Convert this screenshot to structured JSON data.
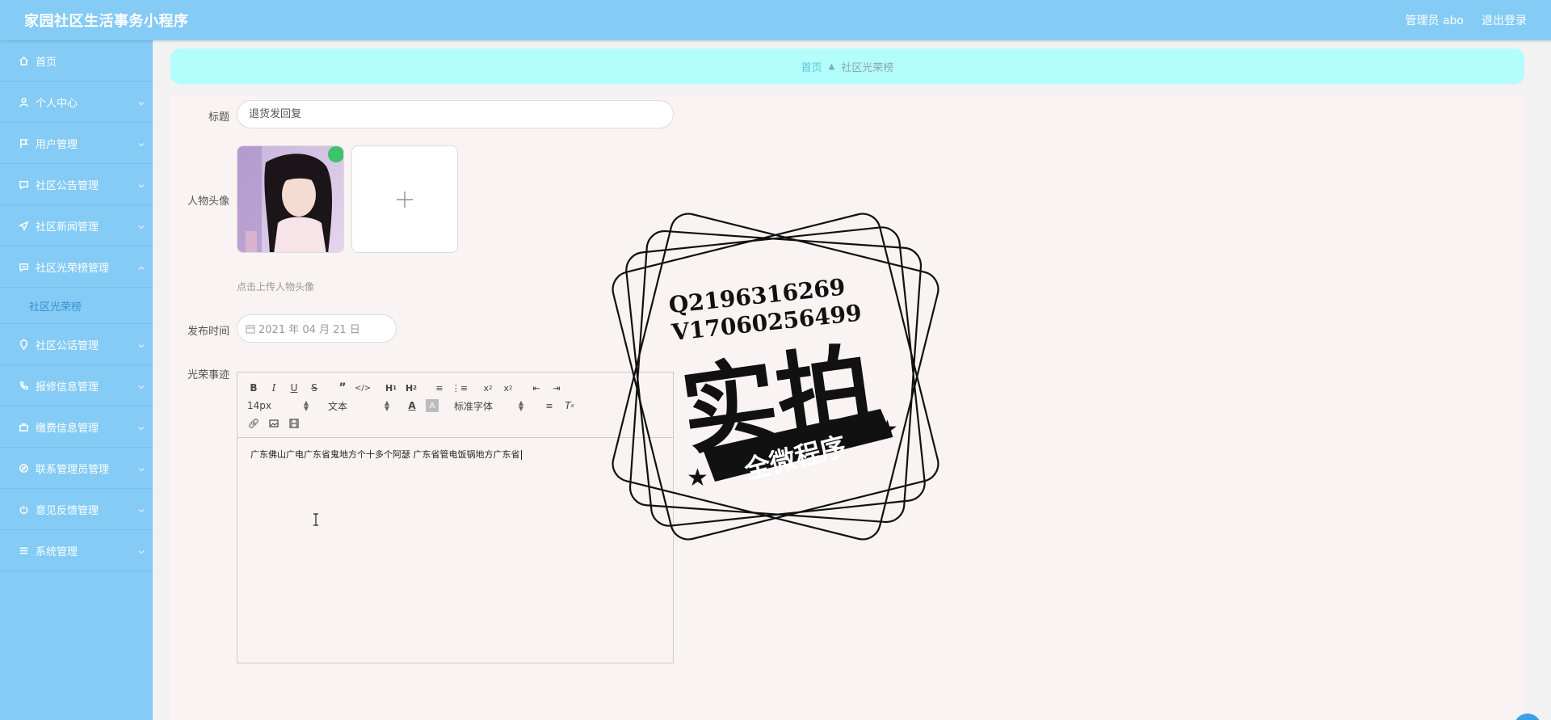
{
  "header": {
    "app_title": "家园社区生活事务小程序",
    "user_label": "管理员 abo",
    "logout_label": "退出登录"
  },
  "sidebar": {
    "items": [
      {
        "label": "首页",
        "icon": "home-icon",
        "has_chevron": false
      },
      {
        "label": "个人中心",
        "icon": "user-icon",
        "has_chevron": true
      },
      {
        "label": "用户管理",
        "icon": "flag-icon",
        "has_chevron": true
      },
      {
        "label": "社区公告管理",
        "icon": "chat-icon",
        "has_chevron": true
      },
      {
        "label": "社区新闻管理",
        "icon": "send-icon",
        "has_chevron": true
      },
      {
        "label": "社区光荣榜管理",
        "icon": "message-icon",
        "has_chevron": true,
        "expanded": true
      },
      {
        "label": "社区公话管理",
        "icon": "location-icon",
        "has_chevron": true
      },
      {
        "label": "报修信息管理",
        "icon": "phone-icon",
        "has_chevron": true
      },
      {
        "label": "缴费信息管理",
        "icon": "briefcase-icon",
        "has_chevron": true
      },
      {
        "label": "联系管理员管理",
        "icon": "compass-icon",
        "has_chevron": true
      },
      {
        "label": "意见反馈管理",
        "icon": "power-icon",
        "has_chevron": true
      },
      {
        "label": "系统管理",
        "icon": "menu-icon",
        "has_chevron": true
      }
    ],
    "sub_item": "社区光荣榜"
  },
  "breadcrumb": {
    "home": "首页",
    "current": "社区光荣榜"
  },
  "form": {
    "title_label": "标题",
    "title_value": "退货发回复",
    "avatar_label": "人物头像",
    "upload_hint": "点击上传人物头像",
    "publish_label": "发布时间",
    "publish_value": "2021 年 04 月 21 日",
    "content_label": "光荣事迹",
    "content_value": "广东佛山广电广东省鬼地方个十多个阿瑟 广东省管电饭锅地方广东省"
  },
  "editor": {
    "font_size": "14px",
    "block_type": "文本",
    "font_family": "标准字体"
  },
  "watermark": {
    "line1": "Q2196316269",
    "line2": "V17060256499",
    "big_text": "实拍",
    "band_text": "全微程序"
  },
  "colors": {
    "header_bg": "#84cbf6",
    "sidebar_bg": "#84cbf6",
    "breadcrumb_bg": "#b3fdfd",
    "panel_bg": "#f9f3f3"
  }
}
